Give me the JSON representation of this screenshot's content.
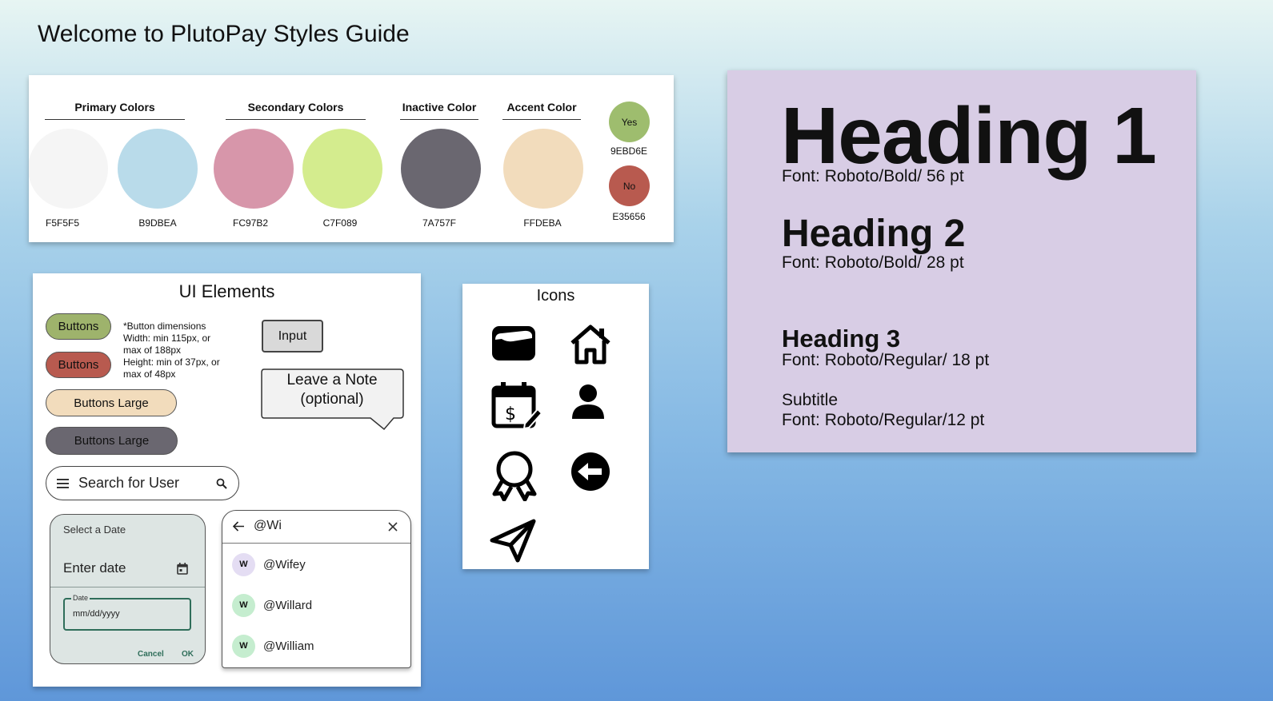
{
  "page": {
    "title": "Welcome to PlutoPay Styles Guide"
  },
  "colors": {
    "groups": {
      "primary": "Primary Colors",
      "secondary": "Secondary Colors",
      "inactive": "Inactive Color",
      "accent": "Accent Color"
    },
    "swatches": [
      {
        "hex": "F5F5F5",
        "color": "#F5F5F5"
      },
      {
        "hex": "B9DBEA",
        "color": "#B9DBEA"
      },
      {
        "hex": "FC97B2",
        "color": "#D796AA"
      },
      {
        "hex": "C7F089",
        "color": "#D4EC8E"
      },
      {
        "hex": "7A757F",
        "color": "#6A6770"
      },
      {
        "hex": "FFDEBA",
        "color": "#F2DCBC"
      }
    ],
    "yes": {
      "label": "Yes",
      "hex": "9EBD6E",
      "color": "#9EBD6E"
    },
    "no": {
      "label": "No",
      "hex": "E35656",
      "color": "#B85A4F"
    }
  },
  "ui": {
    "title": "UI Elements",
    "buttons": {
      "green": "Buttons",
      "red": "Buttons",
      "large_light": "Buttons Large",
      "large_dark": "Buttons Large"
    },
    "button_colors": {
      "green": "#9EB36C",
      "red": "#B85A4F",
      "large_light": "#F2DCBC",
      "large_dark": "#6A6770"
    },
    "dimensions_note": [
      "*Button dimensions",
      "Width: min 115px, or",
      "max of 188px",
      "Height: min of 37px, or",
      "max of 48px"
    ],
    "input_label": "Input",
    "note_bubble": [
      "Leave a Note",
      "(optional)"
    ],
    "search": {
      "text": "Search for User"
    },
    "date_picker": {
      "header": "Select a Date",
      "enter": "Enter date",
      "field_label": "Date",
      "field_value": "mm/dd/yyyy",
      "cancel": "Cancel",
      "ok": "OK"
    },
    "suggestions": {
      "query": "@Wi",
      "items": [
        {
          "initial": "W",
          "name": "@Wifey",
          "color": "#E4DDF3"
        },
        {
          "initial": "W",
          "name": "@Willard",
          "color": "#C5EDCF"
        },
        {
          "initial": "W",
          "name": "@William",
          "color": "#C5EDCF"
        }
      ]
    }
  },
  "icons": {
    "title": "Icons",
    "items": [
      "wallet-icon",
      "home-icon",
      "calendar-payment-icon",
      "user-icon",
      "award-icon",
      "back-arrow-icon",
      "send-icon"
    ]
  },
  "typography": {
    "h1": "Heading 1",
    "h1_font": "Font: Roboto/Bold/ 56 pt",
    "h2": "Heading 2",
    "h2_font": "Font: Roboto/Bold/ 28 pt",
    "h3": "Heading 3",
    "h3_font": "Font: Roboto/Regular/ 18 pt",
    "subtitle": "Subtitle",
    "subtitle_font": "Font: Roboto/Regular/12 pt"
  }
}
